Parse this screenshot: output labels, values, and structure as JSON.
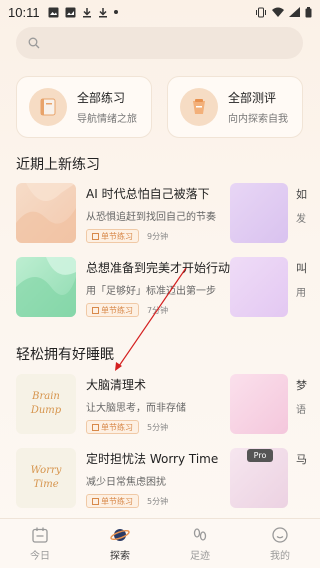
{
  "status_bar": {
    "time": "10:11"
  },
  "search": {
    "placeholder": ""
  },
  "features": [
    {
      "title": "全部练习",
      "subtitle": "导航情绪之旅",
      "icon": "book-icon"
    },
    {
      "title": "全部测评",
      "subtitle": "向内探索自我",
      "icon": "cup-icon"
    }
  ],
  "sections": {
    "recent": "近期上新练习",
    "sleep": "轻松拥有好睡眠"
  },
  "recent_items": [
    {
      "title": "AI 时代总怕自己被落下",
      "desc": "从恐惧追赶到找回自己的节奏",
      "tag": "单节练习",
      "duration": "9分钟",
      "peek": "如",
      "peek2": "发"
    },
    {
      "title": "总想准备到完美才开始行动",
      "desc": "用「足够好」标准迈出第一步",
      "tag": "单节练习",
      "duration": "7分钟",
      "peek": "叫",
      "peek2": "用"
    }
  ],
  "sleep_items": [
    {
      "title": "大脑清理术",
      "desc": "让大脑思考，而非存储",
      "tag": "单节练习",
      "duration": "5分钟",
      "thumb_text": [
        "Brain",
        "Dump"
      ],
      "peek": "梦",
      "peek2": "语"
    },
    {
      "title": "定时担忧法 Worry Time",
      "desc": "减少日常焦虑困扰",
      "tag": "单节练习",
      "duration": "5分钟",
      "thumb_text": [
        "Worry",
        "Time"
      ],
      "peek": "马",
      "peek2": ""
    }
  ],
  "pro_badge": "Pro",
  "nav": [
    {
      "label": "今日",
      "icon": "calendar-icon"
    },
    {
      "label": "探索",
      "icon": "planet-icon"
    },
    {
      "label": "足迹",
      "icon": "footprint-icon"
    },
    {
      "label": "我的",
      "icon": "smile-icon"
    }
  ],
  "colors": {
    "accent": "#d8894a",
    "active_nav": "#333333"
  }
}
